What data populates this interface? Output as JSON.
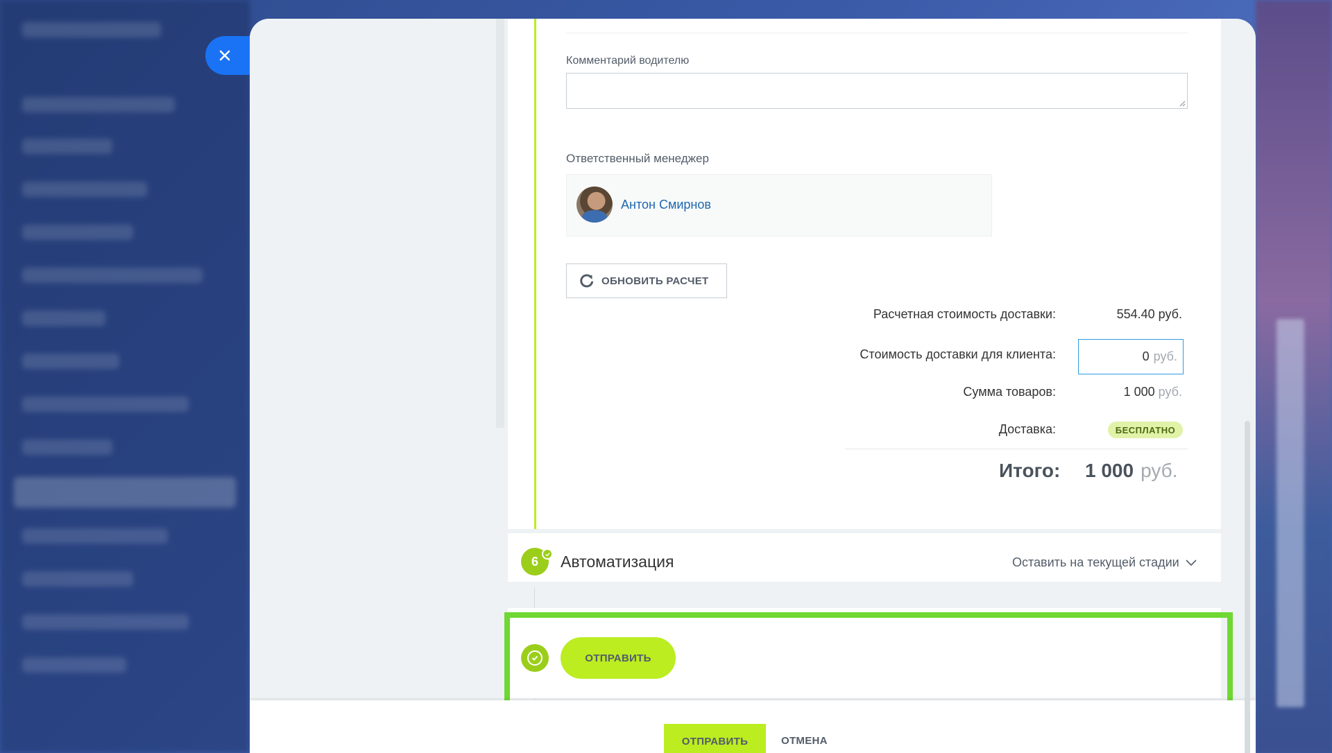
{
  "form": {
    "comment_label": "Комментарий водителю",
    "comment_value": "",
    "manager_label": "Ответственный менеджер",
    "manager_name": "Антон Смирнов",
    "refresh_label": "ОБНОВИТЬ РАСЧЕТ"
  },
  "summary": {
    "estimated_label": "Расчетная стоимость доставки:",
    "estimated_value": "554.40 руб.",
    "client_label": "Стоимость доставки для клиента:",
    "client_value": "0",
    "client_currency": "руб.",
    "goods_label": "Сумма товаров:",
    "goods_value": "1 000",
    "goods_currency": "руб.",
    "delivery_label": "Доставка:",
    "delivery_badge": "БЕСПЛАТНО",
    "total_label": "Итого:",
    "total_value": "1 000",
    "total_currency": "руб."
  },
  "automation": {
    "step_number": "6",
    "title": "Автоматизация",
    "stage_select": "Оставить на текущей стадии"
  },
  "actions": {
    "send_label": "ОТПРАВИТЬ",
    "footer_send_label": "ОТПРАВИТЬ",
    "footer_cancel_label": "ОТМЕНА"
  },
  "colors": {
    "accent_green": "#bbed21",
    "step_green": "#9bce1a",
    "highlight_green": "#6fd833",
    "close_blue": "#1a73f5",
    "link_blue": "#2067b0"
  },
  "icons": {
    "close": "close-icon",
    "refresh": "refresh-icon",
    "check": "check-icon",
    "chevron": "chevron-down-icon"
  }
}
